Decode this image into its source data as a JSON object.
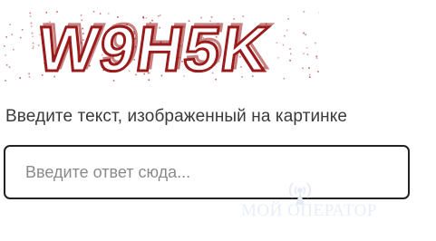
{
  "captcha": {
    "text": "W9H5K",
    "fill_color": "#ffffff",
    "outline_color": "#9a1b1b",
    "noise_color": "#b03030"
  },
  "form": {
    "prompt": "Введите текст, изображенный на картинке",
    "answer_value": "",
    "answer_placeholder": "Введите ответ сюда..."
  },
  "watermark": {
    "text": "МОЙ ОПЕРАТОР",
    "icon": "signal-tower-icon"
  }
}
